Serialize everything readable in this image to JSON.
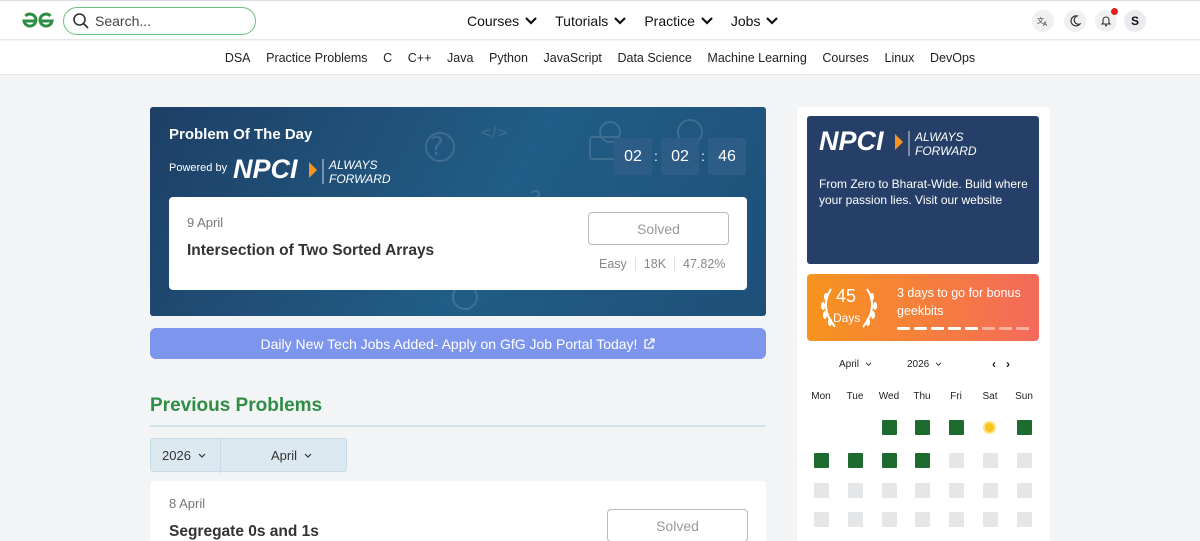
{
  "header": {
    "search_placeholder": "Search...",
    "nav": [
      {
        "label": "Courses"
      },
      {
        "label": "Tutorials"
      },
      {
        "label": "Practice"
      },
      {
        "label": "Jobs"
      }
    ],
    "avatar_letter": "S",
    "icons": [
      "translate-icon",
      "moon-icon",
      "bell-icon"
    ]
  },
  "subnav": [
    "DSA",
    "Practice Problems",
    "C",
    "C++",
    "Java",
    "Python",
    "JavaScript",
    "Data Science",
    "Machine Learning",
    "Courses",
    "Linux",
    "DevOps"
  ],
  "potd": {
    "title": "Problem Of The Day",
    "powered_by": "Powered by",
    "timer": [
      "02",
      "02",
      "46"
    ],
    "date": "9 April",
    "problem": "Intersection of Two Sorted Arrays",
    "status": "Solved",
    "difficulty": "Easy",
    "submissions": "18K",
    "accuracy": "47.82%"
  },
  "jobs_banner": "Daily New Tech Jobs Added- Apply on GfG Job Portal Today!",
  "previous": {
    "title": "Previous Problems",
    "year": "2026",
    "month": "April",
    "card": {
      "date": "8 April",
      "problem": "Segregate 0s and 1s",
      "status": "Solved"
    }
  },
  "sidebar": {
    "ad": {
      "brand": "NPCI",
      "tagline_1": "ALWAYS",
      "tagline_2": "FORWARD",
      "text": "From Zero to Bharat-Wide. Build where your passion lies. Visit our website"
    },
    "streak": {
      "count": "45",
      "unit": "Days",
      "text": "3 days to go for bonus geekbits",
      "progress": 0.625
    },
    "calendar": {
      "month": "April",
      "year": "2026",
      "prev": "‹",
      "next": "›",
      "weekdays": [
        "Mon",
        "Tue",
        "Wed",
        "Thu",
        "Fri",
        "Sat",
        "Sun"
      ]
    }
  },
  "colors": {
    "brand_green": "#2f8d46",
    "potd_bg": "#1e3f66",
    "banner": "#7e95ee",
    "streak_start": "#f7941d",
    "streak_end": "#f46a5b",
    "done": "#1d6b2e"
  }
}
